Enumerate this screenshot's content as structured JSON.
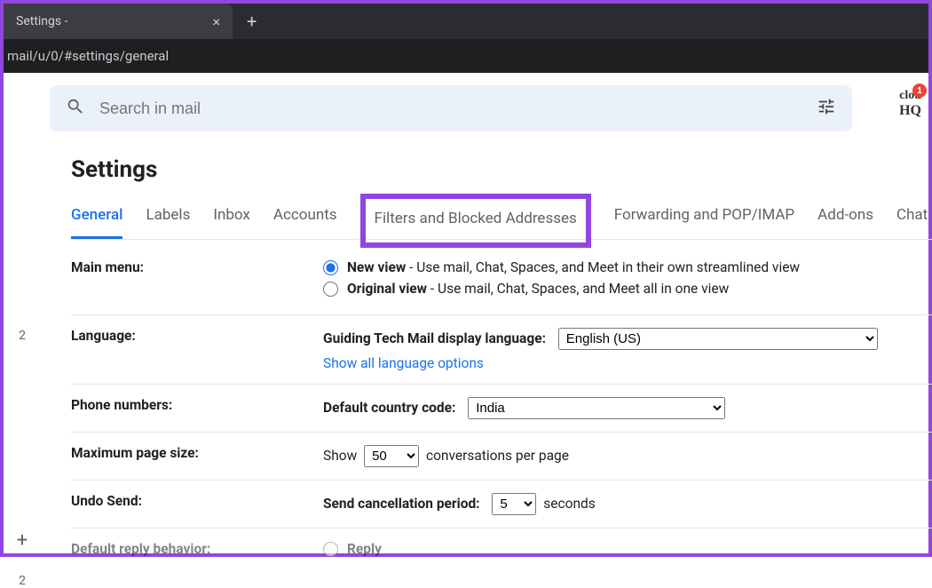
{
  "browser": {
    "tab_title": "Settings -",
    "url": "mail/u/0/#settings/general"
  },
  "search": {
    "placeholder": "Search in mail"
  },
  "logo": {
    "line1": "clou",
    "line2": "HQ",
    "badge": "1"
  },
  "page": {
    "title": "Settings"
  },
  "tabs": [
    {
      "label": "General",
      "active": true
    },
    {
      "label": "Labels"
    },
    {
      "label": "Inbox"
    },
    {
      "label": "Accounts"
    },
    {
      "label": "Filters and Blocked Addresses",
      "highlighted": true
    },
    {
      "label": "Forwarding and POP/IMAP"
    },
    {
      "label": "Add-ons"
    },
    {
      "label": "Chat"
    }
  ],
  "settings": {
    "main_menu": {
      "label": "Main menu:",
      "options": [
        {
          "title": "New view",
          "desc": " - Use mail, Chat, Spaces, and Meet in their own streamlined view",
          "checked": true
        },
        {
          "title": "Original view",
          "desc": " - Use mail, Chat, Spaces, and Meet all in one view",
          "checked": false
        }
      ]
    },
    "language": {
      "label": "Language:",
      "display_label": "Guiding Tech Mail display language:",
      "selected": "English (US)",
      "show_all": "Show all language options"
    },
    "phone": {
      "label": "Phone numbers:",
      "code_label": "Default country code:",
      "selected": "India"
    },
    "page_size": {
      "label": "Maximum page size:",
      "prefix": "Show",
      "selected": "50",
      "suffix": "conversations per page"
    },
    "undo": {
      "label": "Undo Send:",
      "period_label": "Send cancellation period:",
      "selected": "5",
      "suffix": "seconds"
    },
    "reply": {
      "label": "Default reply behavior:",
      "option": "Reply"
    }
  },
  "leftrail": {
    "count1": "2",
    "count2": "2"
  }
}
